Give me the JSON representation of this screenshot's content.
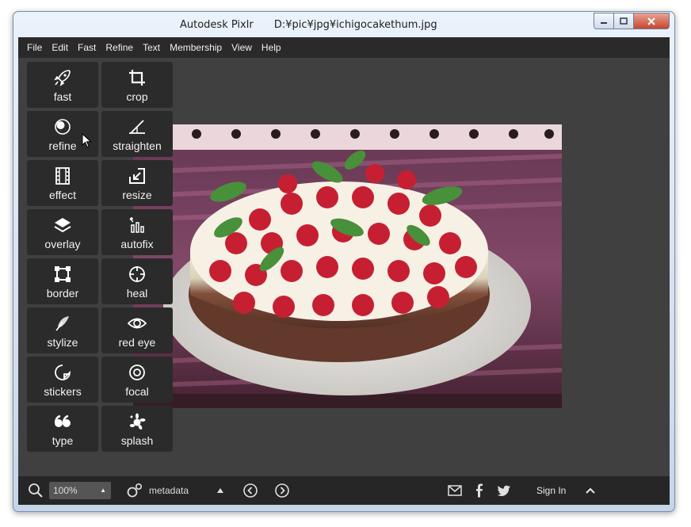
{
  "window": {
    "app_title": "Autodesk Pixlr",
    "file_path": "D:¥pic¥jpg¥ichigocakethum.jpg",
    "minimize_label": "▭",
    "maximize_label": "▢",
    "close_label": "✕"
  },
  "menu": [
    "File",
    "Edit",
    "Fast",
    "Refine",
    "Text",
    "Membership",
    "View",
    "Help"
  ],
  "tools": [
    {
      "label": "fast",
      "icon": "rocket-icon"
    },
    {
      "label": "crop",
      "icon": "crop-icon"
    },
    {
      "label": "refine",
      "icon": "refine-icon"
    },
    {
      "label": "straighten",
      "icon": "straighten-icon"
    },
    {
      "label": "effect",
      "icon": "film-icon"
    },
    {
      "label": "resize",
      "icon": "resize-icon"
    },
    {
      "label": "overlay",
      "icon": "layers-icon"
    },
    {
      "label": "autofix",
      "icon": "autofix-icon"
    },
    {
      "label": "border",
      "icon": "border-icon"
    },
    {
      "label": "heal",
      "icon": "crosshair-icon"
    },
    {
      "label": "stylize",
      "icon": "feather-icon"
    },
    {
      "label": "red eye",
      "icon": "eye-icon"
    },
    {
      "label": "stickers",
      "icon": "sticker-icon"
    },
    {
      "label": "focal",
      "icon": "target-icon"
    },
    {
      "label": "type",
      "icon": "quote-icon"
    },
    {
      "label": "splash",
      "icon": "splash-icon"
    }
  ],
  "statusbar": {
    "zoom_value": "100%",
    "metadata_label": "metadata",
    "sign_in_label": "Sign In"
  },
  "colors": {
    "menubar_bg": "#2a2a2a",
    "canvas_bg": "#404040",
    "tool_bg": "#2b2b2b",
    "statusbar_bg": "#262626",
    "titlebar_close": "#c7462d"
  }
}
